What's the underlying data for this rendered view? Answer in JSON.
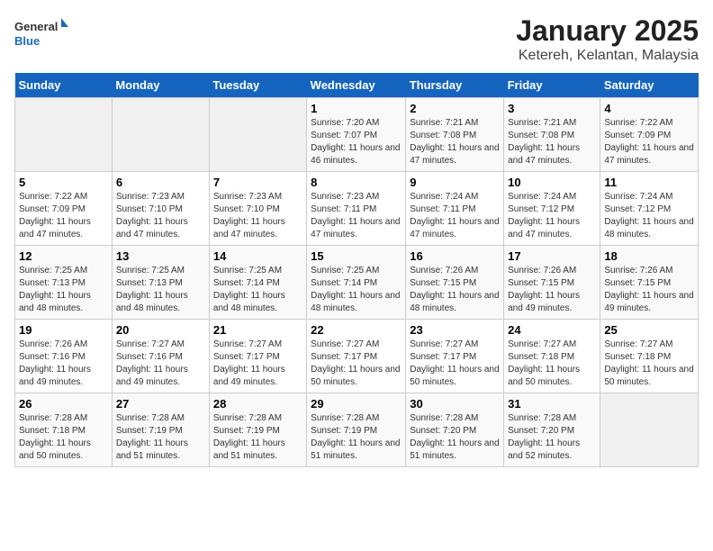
{
  "header": {
    "logo_general": "General",
    "logo_blue": "Blue",
    "title": "January 2025",
    "subtitle": "Ketereh, Kelantan, Malaysia"
  },
  "weekdays": [
    "Sunday",
    "Monday",
    "Tuesday",
    "Wednesday",
    "Thursday",
    "Friday",
    "Saturday"
  ],
  "weeks": [
    [
      {
        "day": "",
        "sunrise": "",
        "sunset": "",
        "daylight": ""
      },
      {
        "day": "",
        "sunrise": "",
        "sunset": "",
        "daylight": ""
      },
      {
        "day": "",
        "sunrise": "",
        "sunset": "",
        "daylight": ""
      },
      {
        "day": "1",
        "sunrise": "Sunrise: 7:20 AM",
        "sunset": "Sunset: 7:07 PM",
        "daylight": "Daylight: 11 hours and 46 minutes."
      },
      {
        "day": "2",
        "sunrise": "Sunrise: 7:21 AM",
        "sunset": "Sunset: 7:08 PM",
        "daylight": "Daylight: 11 hours and 47 minutes."
      },
      {
        "day": "3",
        "sunrise": "Sunrise: 7:21 AM",
        "sunset": "Sunset: 7:08 PM",
        "daylight": "Daylight: 11 hours and 47 minutes."
      },
      {
        "day": "4",
        "sunrise": "Sunrise: 7:22 AM",
        "sunset": "Sunset: 7:09 PM",
        "daylight": "Daylight: 11 hours and 47 minutes."
      }
    ],
    [
      {
        "day": "5",
        "sunrise": "Sunrise: 7:22 AM",
        "sunset": "Sunset: 7:09 PM",
        "daylight": "Daylight: 11 hours and 47 minutes."
      },
      {
        "day": "6",
        "sunrise": "Sunrise: 7:23 AM",
        "sunset": "Sunset: 7:10 PM",
        "daylight": "Daylight: 11 hours and 47 minutes."
      },
      {
        "day": "7",
        "sunrise": "Sunrise: 7:23 AM",
        "sunset": "Sunset: 7:10 PM",
        "daylight": "Daylight: 11 hours and 47 minutes."
      },
      {
        "day": "8",
        "sunrise": "Sunrise: 7:23 AM",
        "sunset": "Sunset: 7:11 PM",
        "daylight": "Daylight: 11 hours and 47 minutes."
      },
      {
        "day": "9",
        "sunrise": "Sunrise: 7:24 AM",
        "sunset": "Sunset: 7:11 PM",
        "daylight": "Daylight: 11 hours and 47 minutes."
      },
      {
        "day": "10",
        "sunrise": "Sunrise: 7:24 AM",
        "sunset": "Sunset: 7:12 PM",
        "daylight": "Daylight: 11 hours and 47 minutes."
      },
      {
        "day": "11",
        "sunrise": "Sunrise: 7:24 AM",
        "sunset": "Sunset: 7:12 PM",
        "daylight": "Daylight: 11 hours and 48 minutes."
      }
    ],
    [
      {
        "day": "12",
        "sunrise": "Sunrise: 7:25 AM",
        "sunset": "Sunset: 7:13 PM",
        "daylight": "Daylight: 11 hours and 48 minutes."
      },
      {
        "day": "13",
        "sunrise": "Sunrise: 7:25 AM",
        "sunset": "Sunset: 7:13 PM",
        "daylight": "Daylight: 11 hours and 48 minutes."
      },
      {
        "day": "14",
        "sunrise": "Sunrise: 7:25 AM",
        "sunset": "Sunset: 7:14 PM",
        "daylight": "Daylight: 11 hours and 48 minutes."
      },
      {
        "day": "15",
        "sunrise": "Sunrise: 7:25 AM",
        "sunset": "Sunset: 7:14 PM",
        "daylight": "Daylight: 11 hours and 48 minutes."
      },
      {
        "day": "16",
        "sunrise": "Sunrise: 7:26 AM",
        "sunset": "Sunset: 7:15 PM",
        "daylight": "Daylight: 11 hours and 48 minutes."
      },
      {
        "day": "17",
        "sunrise": "Sunrise: 7:26 AM",
        "sunset": "Sunset: 7:15 PM",
        "daylight": "Daylight: 11 hours and 49 minutes."
      },
      {
        "day": "18",
        "sunrise": "Sunrise: 7:26 AM",
        "sunset": "Sunset: 7:15 PM",
        "daylight": "Daylight: 11 hours and 49 minutes."
      }
    ],
    [
      {
        "day": "19",
        "sunrise": "Sunrise: 7:26 AM",
        "sunset": "Sunset: 7:16 PM",
        "daylight": "Daylight: 11 hours and 49 minutes."
      },
      {
        "day": "20",
        "sunrise": "Sunrise: 7:27 AM",
        "sunset": "Sunset: 7:16 PM",
        "daylight": "Daylight: 11 hours and 49 minutes."
      },
      {
        "day": "21",
        "sunrise": "Sunrise: 7:27 AM",
        "sunset": "Sunset: 7:17 PM",
        "daylight": "Daylight: 11 hours and 49 minutes."
      },
      {
        "day": "22",
        "sunrise": "Sunrise: 7:27 AM",
        "sunset": "Sunset: 7:17 PM",
        "daylight": "Daylight: 11 hours and 50 minutes."
      },
      {
        "day": "23",
        "sunrise": "Sunrise: 7:27 AM",
        "sunset": "Sunset: 7:17 PM",
        "daylight": "Daylight: 11 hours and 50 minutes."
      },
      {
        "day": "24",
        "sunrise": "Sunrise: 7:27 AM",
        "sunset": "Sunset: 7:18 PM",
        "daylight": "Daylight: 11 hours and 50 minutes."
      },
      {
        "day": "25",
        "sunrise": "Sunrise: 7:27 AM",
        "sunset": "Sunset: 7:18 PM",
        "daylight": "Daylight: 11 hours and 50 minutes."
      }
    ],
    [
      {
        "day": "26",
        "sunrise": "Sunrise: 7:28 AM",
        "sunset": "Sunset: 7:18 PM",
        "daylight": "Daylight: 11 hours and 50 minutes."
      },
      {
        "day": "27",
        "sunrise": "Sunrise: 7:28 AM",
        "sunset": "Sunset: 7:19 PM",
        "daylight": "Daylight: 11 hours and 51 minutes."
      },
      {
        "day": "28",
        "sunrise": "Sunrise: 7:28 AM",
        "sunset": "Sunset: 7:19 PM",
        "daylight": "Daylight: 11 hours and 51 minutes."
      },
      {
        "day": "29",
        "sunrise": "Sunrise: 7:28 AM",
        "sunset": "Sunset: 7:19 PM",
        "daylight": "Daylight: 11 hours and 51 minutes."
      },
      {
        "day": "30",
        "sunrise": "Sunrise: 7:28 AM",
        "sunset": "Sunset: 7:20 PM",
        "daylight": "Daylight: 11 hours and 51 minutes."
      },
      {
        "day": "31",
        "sunrise": "Sunrise: 7:28 AM",
        "sunset": "Sunset: 7:20 PM",
        "daylight": "Daylight: 11 hours and 52 minutes."
      },
      {
        "day": "",
        "sunrise": "",
        "sunset": "",
        "daylight": ""
      }
    ]
  ]
}
